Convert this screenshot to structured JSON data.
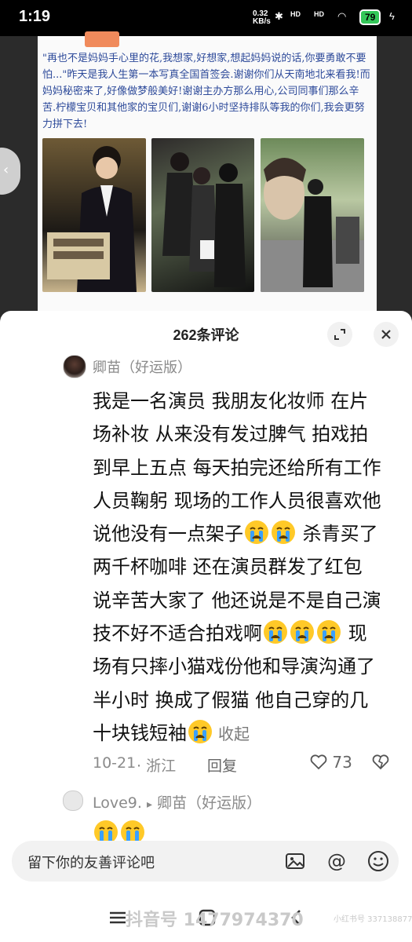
{
  "status_bar": {
    "time": "1:19",
    "network_speed_top": "0.32",
    "network_speed_unit": "KB/s",
    "signal_1": "HD",
    "signal_2": "HD",
    "battery": "79"
  },
  "post": {
    "text": "\"再也不是妈妈手心里的花,我想家,好想家,想起妈妈说的话,你要勇敢不要怕...\"昨天是我人生第一本写真全国首签会.谢谢你们从天南地北来看我!而妈妈秘密来了,好像做梦般美好!谢谢主办方那么用心,公司同事们那么辛苦.柠檬宝贝和其他家的宝贝们,谢谢6小时坚持排队等我的你们,我会更努力拼下去!",
    "side_arrow": "‹"
  },
  "comments_panel": {
    "title": "262条评论",
    "comment": {
      "username": "卿苗（好运版）",
      "text_part1": "我是一名演员 我朋友化妆师 在片场补妆 从来没有发过脾气 拍戏拍到早上五点 每天拍完还给所有工作人员鞠躬 现场的工作人员很喜欢他 说他没有一点架子",
      "text_part2": " 杀青买了两千杯咖啡 还在演员群发了红包 说辛苦大家了 他还说是不是自己演技不好不适合拍戏啊",
      "text_part3": " 现场有只摔小猫戏份他和导演沟通了半小时 换成了假猫 他自己穿的几十块钱短袖",
      "collapse_label": "收起",
      "date": "10-21",
      "location": "· 浙江",
      "reply_label": "回复",
      "likes": "73"
    },
    "reply": {
      "username": "Love9.",
      "arrow": "▸",
      "to_user": "卿苗（好运版）"
    },
    "input_placeholder": "留下你的友善评论吧"
  },
  "watermark": {
    "text": "抖音号 1477974370",
    "small": "小红书号 337138877"
  },
  "colors": {
    "accent_text": "#2d4a9a",
    "meta_gray": "#8a8a8a",
    "battery_green": "#34c759"
  }
}
